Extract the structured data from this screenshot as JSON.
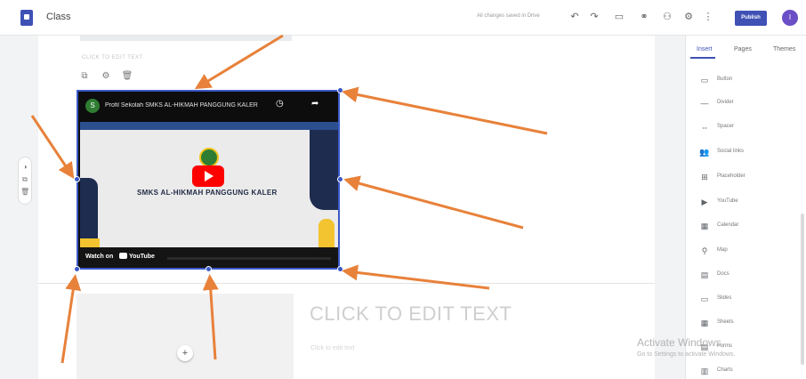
{
  "app": {
    "title": "Class",
    "save_status": "All changes saved in Drive",
    "publish_label": "Publish",
    "avatar_initial": "I"
  },
  "canvas": {
    "header_hint": "CLICK TO EDIT TEXT",
    "heading": "CLICK TO EDIT TEXT",
    "subheading": "Click to edit text",
    "add_symbol": "+"
  },
  "video": {
    "channel_initial": "S",
    "title": "Profil Sekolah SMKS AL-HIKMAH PANGGUNG KALER",
    "school_name": "SMKS AL-HIKMAH PANGGUNG KALER",
    "watch_on": "Watch on",
    "yt_label": "YouTube"
  },
  "right_panel": {
    "tabs": [
      {
        "label": "Insert"
      },
      {
        "label": "Pages"
      },
      {
        "label": "Themes"
      }
    ],
    "items": [
      {
        "label": "Button",
        "icon": "button-icon"
      },
      {
        "label": "Divider",
        "icon": "divider-icon"
      },
      {
        "label": "Spacer",
        "icon": "spacer-icon"
      },
      {
        "label": "Social links",
        "icon": "social-links-icon"
      },
      {
        "label": "Placeholder",
        "icon": "placeholder-icon"
      },
      {
        "label": "YouTube",
        "icon": "youtube-icon"
      },
      {
        "label": "Calendar",
        "icon": "calendar-icon"
      },
      {
        "label": "Map",
        "icon": "map-icon"
      },
      {
        "label": "Docs",
        "icon": "docs-icon"
      },
      {
        "label": "Slides",
        "icon": "slides-icon"
      },
      {
        "label": "Sheets",
        "icon": "sheets-icon"
      },
      {
        "label": "Forms",
        "icon": "forms-icon"
      },
      {
        "label": "Charts",
        "icon": "charts-icon"
      }
    ]
  },
  "windows": {
    "activate_title": "Activate Windows",
    "activate_sub": "Go to Settings to activate Windows."
  },
  "colors": {
    "accent": "#3f51b5",
    "arrow": "#e8813a",
    "selection": "#3a59c8"
  }
}
